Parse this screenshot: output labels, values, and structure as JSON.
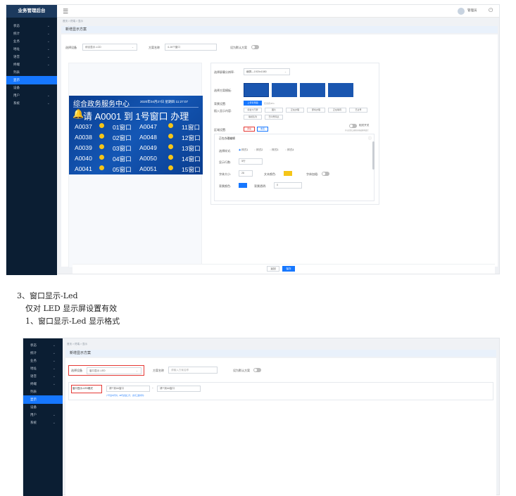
{
  "top": {
    "app_title": "业务管理后台",
    "user": "管理员"
  },
  "sidebar1": [
    "状态",
    "统计",
    "业务",
    "地址",
    "语音",
    "终端",
    "列表",
    "显示",
    "设备",
    "用户",
    "系统"
  ],
  "breadcrumb": "首页 > 终端 > 显示",
  "page_title": "新增显示方案",
  "form": {
    "device_label": "选择设备",
    "device_value": "综合显示-LCD",
    "name_label": "方案名称",
    "name_value": "4-16个窗口",
    "default_label": "设为默认方案"
  },
  "led_preview": {
    "hall_name": "综合政务服务中心",
    "datetime": "2020年04月27日  星期四  11:27:07",
    "call_text": "请 A0001 到 1号窗口 办理",
    "rows": [
      {
        "a": "A0037",
        "w1": "01窗口",
        "b": "A0047",
        "w2": "11窗口"
      },
      {
        "a": "A0038",
        "w1": "02窗口",
        "b": "A0048",
        "w2": "12窗口"
      },
      {
        "a": "A0039",
        "w1": "03窗口",
        "b": "A0049",
        "w2": "13窗口"
      },
      {
        "a": "A0040",
        "w1": "04窗口",
        "b": "A0050",
        "w2": "14窗口"
      },
      {
        "a": "A0041",
        "w1": "05窗口",
        "b": "A0051",
        "w2": "15窗口"
      }
    ]
  },
  "settings": {
    "resolution_label": "选择屏幕分辨率:",
    "resolution_value": "横屏—1920x1080",
    "template_label": "选择方案模板:",
    "bg_label": "背景设置:",
    "bg_button": "上传背景图",
    "bg_hint": "仅支持JPG",
    "insert_label": "插入显示内容:",
    "insert_chips": [
      "综合大厅屏",
      "图片",
      "正在办理",
      "即将办理",
      "正在等待",
      "已过号"
    ],
    "insert_chips2": [
      "等候队列",
      "已叫号码表"
    ],
    "region_label": "区域设置:",
    "region_btn1": "添加",
    "region_btn2": "重置",
    "partial_label": "相关开关",
    "partial_hint": "开启后窗口编辑功能被屏幕锁定",
    "editor_title": "正在办理编辑",
    "style_label": "选择样式:",
    "styles": [
      "样式1",
      "样式2",
      "样式3",
      "样式4"
    ],
    "show_label": "显示行数:",
    "show_value": "5行",
    "font_label": "字体大小:",
    "font_value": "26",
    "color_label": "文本颜色:",
    "bold_label": "字体加粗:",
    "bgcolor_label": "背景颜色:",
    "opacity_label": "背景透明:",
    "opacity_value": "0"
  },
  "footer": {
    "cancel": "返回",
    "save": "保存"
  },
  "doc": {
    "heading": "3、窗口显示-Led",
    "line1": "仅对 LED 显示屏设置有效",
    "line2": "1、窗口显示-Led 显示格式"
  },
  "second": {
    "breadcrumb": "首页 > 终端 > 显示",
    "page_title": "新增显示方案",
    "device_label": "选择设备",
    "device_value": "窗口显示-LED",
    "name_label": "方案名称",
    "name_placeholder": "请输入方案名称",
    "default_label": "设为默认方案",
    "format_label": "窗口显示-LED格式",
    "format_value1": "请**到##窗口",
    "format_value2": "请**到##窗口",
    "format_hint": "(**代表叫号码，##代表窗口号，支持三组排列)",
    "sidebar": [
      "状态",
      "统计",
      "业务",
      "地址",
      "语音",
      "终端",
      "列表",
      "显示",
      "设备",
      "用户",
      "系统"
    ]
  },
  "colors": {
    "sidebar": "#0b1e33",
    "accent": "#1677ff",
    "led_bg": "#0a3d8f",
    "led_yellow": "#f5c518",
    "highlight": "#e53935"
  }
}
